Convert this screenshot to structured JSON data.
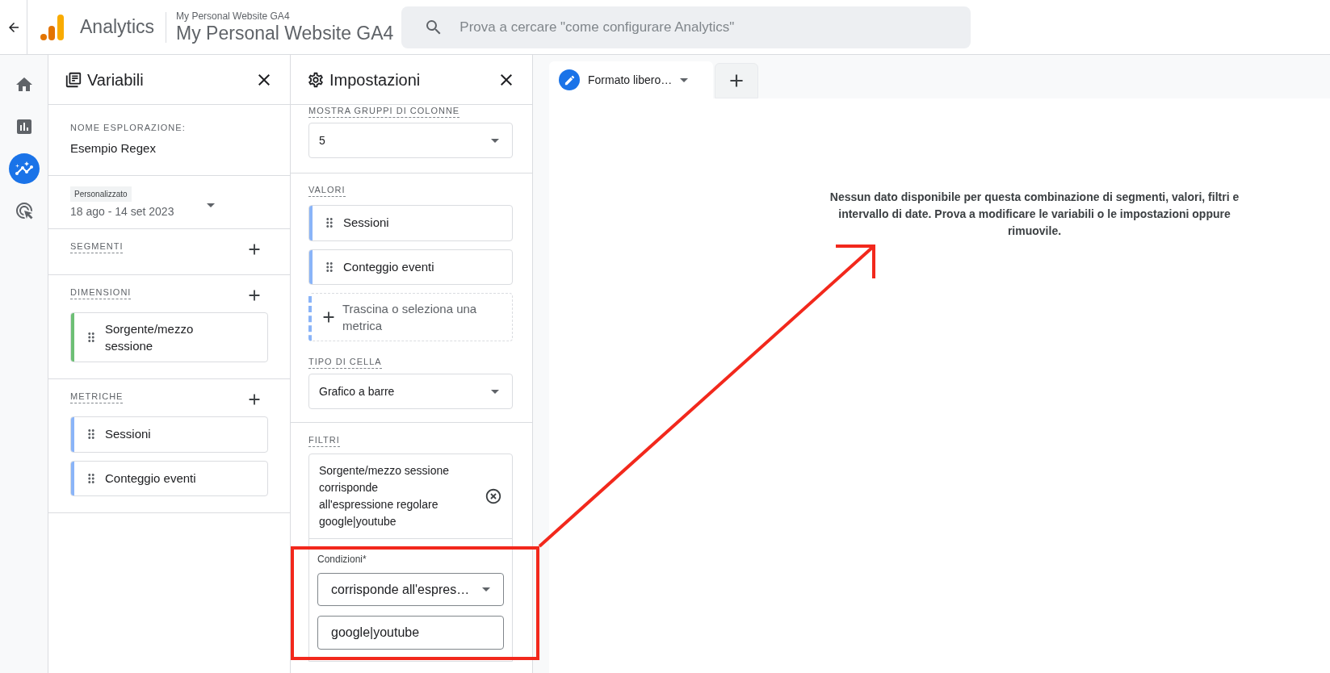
{
  "top_bar": {
    "app_name": "Analytics",
    "account": "My Personal Website GA4",
    "property": "My Personal Website GA4",
    "search": {
      "placeholder": "Prova a cercare \"come configurare Analytics\""
    }
  },
  "nav_rail": [
    {
      "kind": "home",
      "selected": false
    },
    {
      "kind": "reports",
      "selected": false
    },
    {
      "kind": "explore",
      "selected": true
    },
    {
      "kind": "advertising",
      "selected": false
    }
  ],
  "variables_panel": {
    "title": "Variabili",
    "exploration_name_label": "NOME ESPLORAZIONE:",
    "exploration_name": "Esempio Regex",
    "date_range": {
      "badge": "Personalizzato",
      "value": "18 ago - 14 set 2023"
    },
    "sections": [
      {
        "label": "SEGMENTI"
      },
      {
        "label": "DIMENSIONI",
        "items": [
          {
            "name": "Sorgente/mezzo sessione",
            "color": "#6dbf75"
          }
        ]
      },
      {
        "label": "METRICHE",
        "items": [
          {
            "name": "Sessioni",
            "color": "#8ab4f8"
          },
          {
            "name": "Conteggio eventi",
            "color": "#8ab4f8"
          }
        ]
      }
    ]
  },
  "settings_panel": {
    "title": "Impostazioni",
    "column_groups": {
      "label": "MOSTRA GRUPPI DI COLONNE",
      "value": "5"
    },
    "values": {
      "label": "VALORI",
      "items": [
        {
          "name": "Sessioni",
          "color": "#8ab4f8"
        },
        {
          "name": "Conteggio eventi",
          "color": "#8ab4f8"
        }
      ],
      "drop_hint": "Trascina o seleziona una metrica"
    },
    "cell_type": {
      "label": "TIPO DI CELLA",
      "value": "Grafico a barre"
    },
    "filters": {
      "label": "FILTRI",
      "filter_text": "Sorgente/mezzo sessione corrisponde all'espressione regolare google|youtube",
      "conditions_label": "Condizioni*",
      "condition": "corrisponde all'espres…",
      "expression": "google|youtube"
    }
  },
  "canvas": {
    "tabs": [
      {
        "label": "Formato libero…",
        "selected": true
      }
    ],
    "empty_message": "Nessun dato disponibile per questa combinazione di segmenti, valori, filtri e intervallo di date. Prova a modificare le variabili o le impostazioni oppure rimuovile."
  }
}
